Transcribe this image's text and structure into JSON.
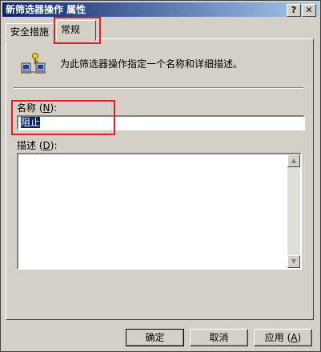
{
  "window": {
    "title": "新筛选器操作 属性",
    "help_label": "?",
    "close_label": "✕"
  },
  "tabs": [
    {
      "label": "安全措施"
    },
    {
      "label": "常规"
    }
  ],
  "panel": {
    "description": "为此筛选器操作指定一个名称和详细描述。",
    "name_label": "名称",
    "name_access_key": "N",
    "name_value": "阻止",
    "desc_label": "描述",
    "desc_access_key": "D",
    "desc_value": ""
  },
  "buttons": {
    "ok": "确定",
    "cancel": "取消",
    "apply": "应用",
    "apply_access_key": "A"
  },
  "icons": {
    "filter": "network-filter-icon",
    "scroll_up": "scroll-up-icon",
    "scroll_down": "scroll-down-icon"
  },
  "colors": {
    "highlight": "#e02020",
    "title_bar": "#0a246a",
    "face": "#d4d0c8"
  }
}
